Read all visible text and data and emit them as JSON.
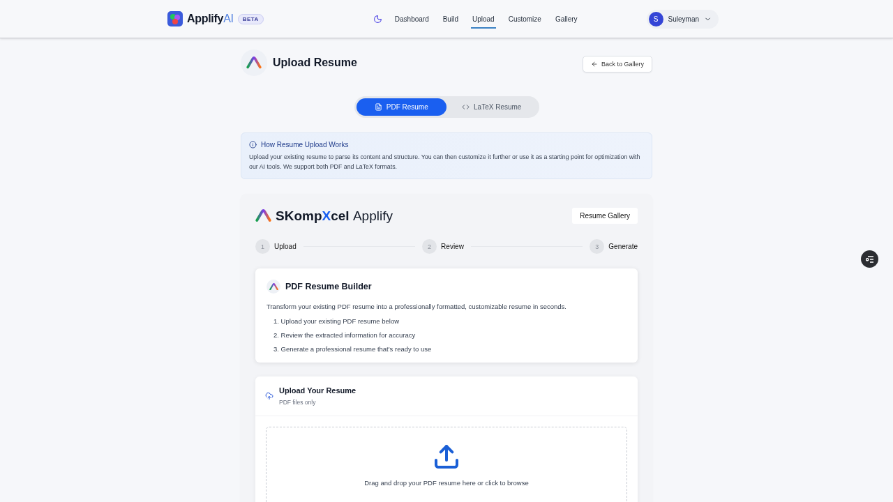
{
  "nav": {
    "logo": {
      "main": "Applify",
      "accent": "AI"
    },
    "badge": "BETA",
    "links": [
      {
        "label": "Dashboard",
        "selected": false
      },
      {
        "label": "Build",
        "selected": false
      },
      {
        "label": "Upload",
        "selected": true
      },
      {
        "label": "Customize",
        "selected": false
      },
      {
        "label": "Gallery",
        "selected": false
      }
    ],
    "user": {
      "initial": "S",
      "name": "Suleyman"
    }
  },
  "page": {
    "title": "Upload Resume",
    "back_button": "Back to Gallery"
  },
  "mode_tabs": [
    {
      "label": "PDF Resume",
      "kind": "pdf",
      "selected": true
    },
    {
      "label": "LaTeX Resume",
      "kind": "latex",
      "selected": false
    }
  ],
  "info": {
    "title": "How Resume Upload Works",
    "text": "Upload your existing resume to parse its content and structure. You can then customize it further or use it as a starting point for optimization with our AI tools. We support both PDF and LaTeX formats."
  },
  "builder": {
    "brand": {
      "lead": "SKomp",
      "accent": "X",
      "tail": "cel",
      "suffix": "Applify"
    },
    "gallery_button": "Resume Gallery",
    "steps": [
      {
        "number": "1",
        "label": "Upload"
      },
      {
        "number": "2",
        "label": "Review"
      },
      {
        "number": "3",
        "label": "Generate"
      }
    ],
    "intro": {
      "title": "PDF Resume Builder",
      "text": "Transform your existing PDF resume into a professionally formatted, customizable resume in seconds.",
      "items": [
        "1. Upload your existing PDF resume below",
        "2. Review the extracted information for accuracy",
        "3. Generate a professional resume that's ready to use"
      ]
    },
    "upload": {
      "title": "Upload Your Resume",
      "subtitle": "PDF files only",
      "drop_text": "Drag and drop your PDF resume here or click to browse"
    }
  }
}
